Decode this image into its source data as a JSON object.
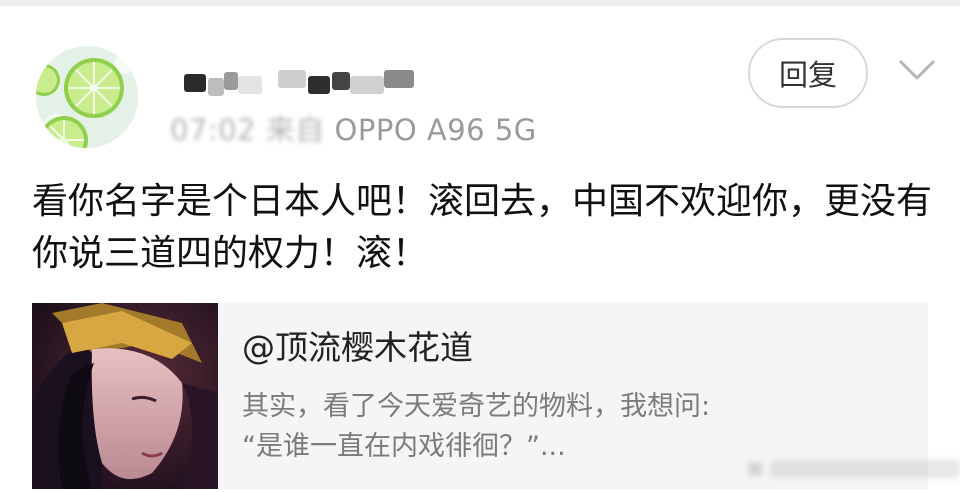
{
  "colors": {
    "background": "#ffffff",
    "card_background": "#f5f5f5",
    "meta_text": "#9a9a9a",
    "quote_text": "#7b7b7b",
    "button_border": "#d8d8d8"
  },
  "post": {
    "meta": {
      "time": "07:02",
      "location": "来自",
      "device": "OPPO A96 5G"
    },
    "reply_label": "回复",
    "comment_text": "看你名字是个日本人吧！滚回去，中国不欢迎你，更没有你说三道四的权力！滚！",
    "icons": {
      "avatar": "lime-slices-avatar",
      "more": "chevron-down-icon"
    }
  },
  "quote": {
    "author": "@顶流樱木花道",
    "text_line1": "其实，看了今天爱奇艺的物料，我想问:",
    "text_line2": "“是谁一直在内戏徘徊？”..."
  }
}
